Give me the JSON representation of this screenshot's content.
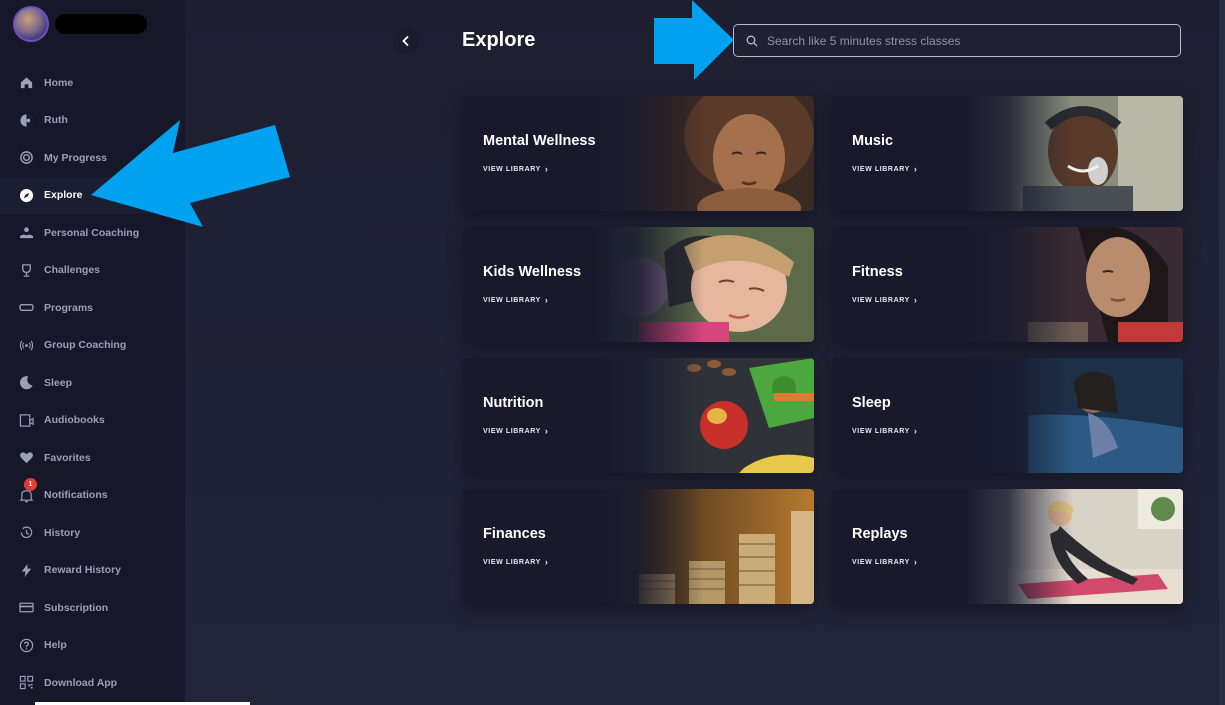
{
  "colors": {
    "accent": "#00a2f0",
    "badge": "#e53935",
    "sidebar_bg": "#16182a",
    "main_bg": "#1f2133"
  },
  "sidebar": {
    "items": [
      {
        "label": "Home",
        "icon": "home-icon"
      },
      {
        "label": "Ruth",
        "icon": "ruth-icon"
      },
      {
        "label": "My Progress",
        "icon": "progress-icon"
      },
      {
        "label": "Explore",
        "icon": "compass-icon",
        "active": true
      },
      {
        "label": "Personal Coaching",
        "icon": "coaching-icon"
      },
      {
        "label": "Challenges",
        "icon": "trophy-icon"
      },
      {
        "label": "Programs",
        "icon": "programs-icon"
      },
      {
        "label": "Group Coaching",
        "icon": "broadcast-icon"
      },
      {
        "label": "Sleep",
        "icon": "moon-icon"
      },
      {
        "label": "Audiobooks",
        "icon": "audiobook-icon"
      },
      {
        "label": "Favorites",
        "icon": "heart-icon"
      },
      {
        "label": "Notifications",
        "icon": "bell-icon",
        "badge": "1"
      },
      {
        "label": "History",
        "icon": "history-icon"
      },
      {
        "label": "Reward History",
        "icon": "bolt-icon"
      },
      {
        "label": "Subscription",
        "icon": "card-icon"
      },
      {
        "label": "Help",
        "icon": "help-icon"
      },
      {
        "label": "Download App",
        "icon": "qr-icon"
      }
    ]
  },
  "header": {
    "title": "Explore",
    "search_placeholder": "Search like 5 minutes stress classes"
  },
  "cards": [
    {
      "title": "Mental Wellness",
      "link": "VIEW LIBRARY"
    },
    {
      "title": "Music",
      "link": "VIEW LIBRARY"
    },
    {
      "title": "Kids Wellness",
      "link": "VIEW LIBRARY"
    },
    {
      "title": "Fitness",
      "link": "VIEW LIBRARY"
    },
    {
      "title": "Nutrition",
      "link": "VIEW LIBRARY"
    },
    {
      "title": "Sleep",
      "link": "VIEW LIBRARY"
    },
    {
      "title": "Finances",
      "link": "VIEW LIBRARY"
    },
    {
      "title": "Replays",
      "link": "VIEW LIBRARY"
    }
  ]
}
